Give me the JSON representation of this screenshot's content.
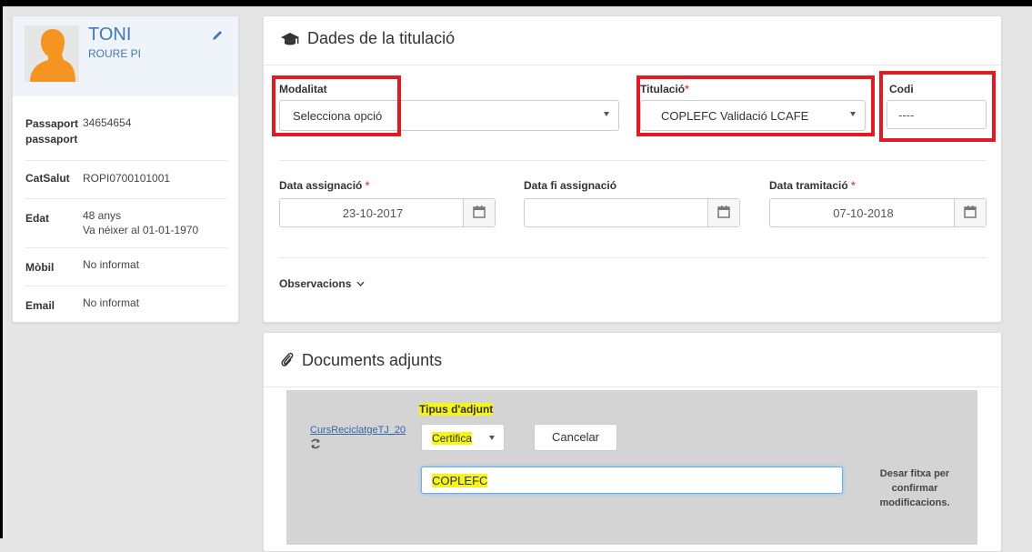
{
  "profile": {
    "name": "TONI",
    "surname": "ROURE PI",
    "rows": [
      {
        "label": "Passaport passaport",
        "value": "34654654"
      },
      {
        "label": "CatSalut",
        "value": "ROPI0700101001"
      },
      {
        "label": "Edat",
        "value": "48 anys",
        "value2": "Va néixer al 01-01-1970"
      },
      {
        "label": "Mòbil",
        "value": "No informat"
      },
      {
        "label": "Email",
        "value": "No informat"
      }
    ]
  },
  "titulacio": {
    "title": "Dades de la titulació",
    "modalitat": {
      "label": "Modalitat",
      "value": "Selecciona opció"
    },
    "titulacio": {
      "label": "Titulació",
      "value": "COPLEFC Validació LCAFE",
      "required": "*"
    },
    "codi": {
      "label": "Codi",
      "value": "----"
    },
    "data_assignacio": {
      "label": "Data assignació",
      "value": "23-10-2017",
      "required": "*"
    },
    "data_fi": {
      "label": "Data fi assignació",
      "value": ""
    },
    "data_tramitacio": {
      "label": "Data tramitació",
      "value": "07-10-2018",
      "required": "*"
    },
    "observacions": "Observacions"
  },
  "documents": {
    "title": "Documents adjunts",
    "file_link": "CursReciclatgeTJ_20",
    "tipus_label": "Tipus d'adjunt",
    "tipus_value": "Certifica",
    "cancel_label": "Cancelar",
    "input_value": "COPLEFC",
    "note": "Desar fitxa per confirmar modificacions."
  },
  "colors": {
    "accent": "#4577b5",
    "highlight_box": "#e01b24",
    "text_highlight": "#f5f51a"
  },
  "icons": [
    "user-avatar",
    "pencil-icon",
    "graduation-cap-icon",
    "calendar-icon",
    "chevron-down-icon",
    "paperclip-icon",
    "refresh-icon"
  ]
}
